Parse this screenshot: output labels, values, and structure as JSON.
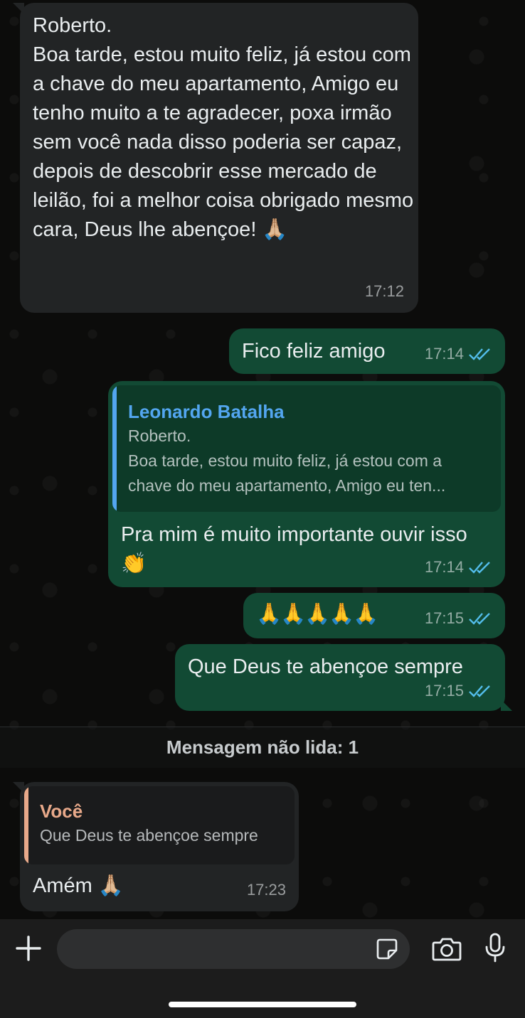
{
  "messages": {
    "m1": {
      "text": "Roberto.\nBoa tarde, estou muito feliz, já estou com a chave do meu apartamento, Amigo eu tenho muito a te agradecer, poxa irmão sem você nada disso poderia ser capaz, depois de descobrir esse mercado de leilão, foi a melhor coisa obrigado mesmo cara, Deus lhe abençoe! 🙏🏼",
      "time": "17:12"
    },
    "m2": {
      "text": "Fico feliz amigo",
      "time": "17:14"
    },
    "m3": {
      "quote_name": "Leonardo Batalha",
      "quote_text": "Roberto.\nBoa tarde, estou muito feliz, já estou com a\nchave do meu apartamento, Amigo eu ten...",
      "text": "Pra mim é muito importante ouvir isso 👏",
      "time": "17:14"
    },
    "m4": {
      "text": "🙏🙏🙏🙏🙏",
      "time": "17:15"
    },
    "m5": {
      "text": "Que Deus te abençoe sempre",
      "time": "17:15"
    },
    "m6": {
      "quote_name": "Você",
      "quote_text": "Que Deus te abençoe sempre",
      "text": "Amém 🙏🏼",
      "time": "17:23"
    }
  },
  "unread_divider": "Mensagem não lida: 1",
  "composer": {
    "placeholder": "",
    "icons": [
      "plus-icon",
      "sticker-icon",
      "camera-icon",
      "microphone-icon"
    ]
  },
  "colors": {
    "incoming_bubble": "#222425",
    "outgoing_bubble": "#124a34",
    "read_ticks": "#53bdeb",
    "quote_name_blue": "#53a6f0",
    "quote_name_peach": "#e8a98a"
  }
}
